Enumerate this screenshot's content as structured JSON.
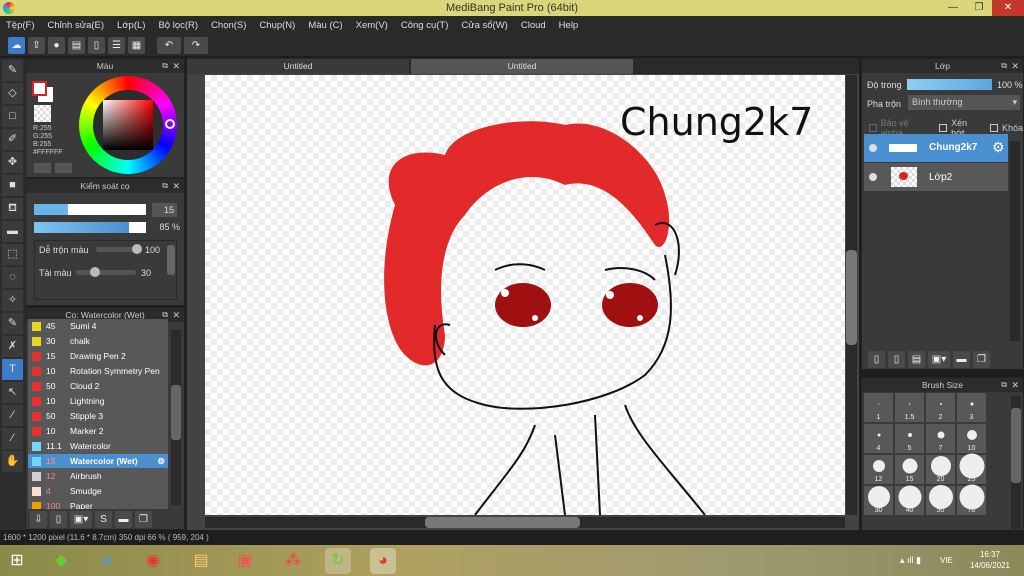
{
  "window": {
    "title": "MediBang Paint Pro (64bit)"
  },
  "menu": [
    "Tệp(F)",
    "Chỉnh sửa(E)",
    "Lớp(L)",
    "Bộ lọc(R)",
    "Chọn(S)",
    "Chụp(N)",
    "Màu (C)",
    "Xem(V)",
    "Công cụ(T)",
    "Cửa sổ(W)",
    "Cloud",
    "Help"
  ],
  "tabs": [
    "Untitled",
    "Untitled"
  ],
  "color_panel": {
    "title": "Màu",
    "r": "R:255",
    "g": "G:255",
    "b": "B:255",
    "hex": "#FFFFFF",
    "accent": "#e02020"
  },
  "brush_control": {
    "title": "Kiểm soát cọ",
    "size": "15",
    "size_fraction": 0.3,
    "opacity": "85 %",
    "opacity_fraction": 0.85,
    "mix_label": "Dễ trộn màu",
    "mix_value": "100",
    "resample_label": "Tải màu",
    "resample_value": "30"
  },
  "brush_list": {
    "title": "Cọ: Watercolor (Wet)",
    "items": [
      {
        "size": "45",
        "name": "Sumi 4",
        "color": "#e8d820"
      },
      {
        "size": "30",
        "name": "chalk",
        "color": "#e8d820"
      },
      {
        "size": "15",
        "name": "Drawing Pen 2",
        "color": "#e83030"
      },
      {
        "size": "10",
        "name": "Rotation Symmetry Pen",
        "color": "#e83030"
      },
      {
        "size": "50",
        "name": "Cloud 2",
        "color": "#e83030"
      },
      {
        "size": "10",
        "name": "Lightning",
        "color": "#e83030"
      },
      {
        "size": "50",
        "name": "Stipple 3",
        "color": "#e83030"
      },
      {
        "size": "10",
        "name": "Marker 2",
        "color": "#e83030"
      },
      {
        "size": "11.1",
        "name": "Watercolor",
        "color": "#70d8f8"
      },
      {
        "size": "15",
        "name": "Watercolor (Wet)",
        "color": "#70d8f8",
        "selected": true
      },
      {
        "size": "12",
        "name": "Airbrush",
        "color": "#d0d0d0"
      },
      {
        "size": "4",
        "name": "Smudge",
        "color": "#f8e0d0"
      },
      {
        "size": "100",
        "name": "Paper",
        "color": "#f0a000"
      }
    ]
  },
  "layer_panel": {
    "title": "Lớp",
    "opacity_label": "Độ trong",
    "opacity": "100 %",
    "opacity_fraction": 1,
    "blend_label": "Pha trộn",
    "blend_value": "Bình thường",
    "protect_alpha": "Bảo vệ alpha",
    "clipping": "Xén bớt",
    "lock": "Khóa",
    "layers": [
      {
        "name": "Chung2k7",
        "selected": true
      },
      {
        "name": "Lớp2"
      }
    ]
  },
  "brush_size": {
    "title": "Brush Size",
    "sizes": [
      "1",
      "1.5",
      "2",
      "3",
      "4",
      "5",
      "7",
      "10",
      "12",
      "15",
      "20",
      "25",
      "30",
      "40",
      "50",
      "70"
    ]
  },
  "canvas": {
    "text": "Chung2k7"
  },
  "status": {
    "text": "1600 * 1200 pixel   (11.6 * 8.7cm)   350 dpi   66 %   ( 959, 204 )"
  },
  "taskbar": {
    "lang": "VIE",
    "time": "16:37",
    "date": "14/06/2021"
  }
}
